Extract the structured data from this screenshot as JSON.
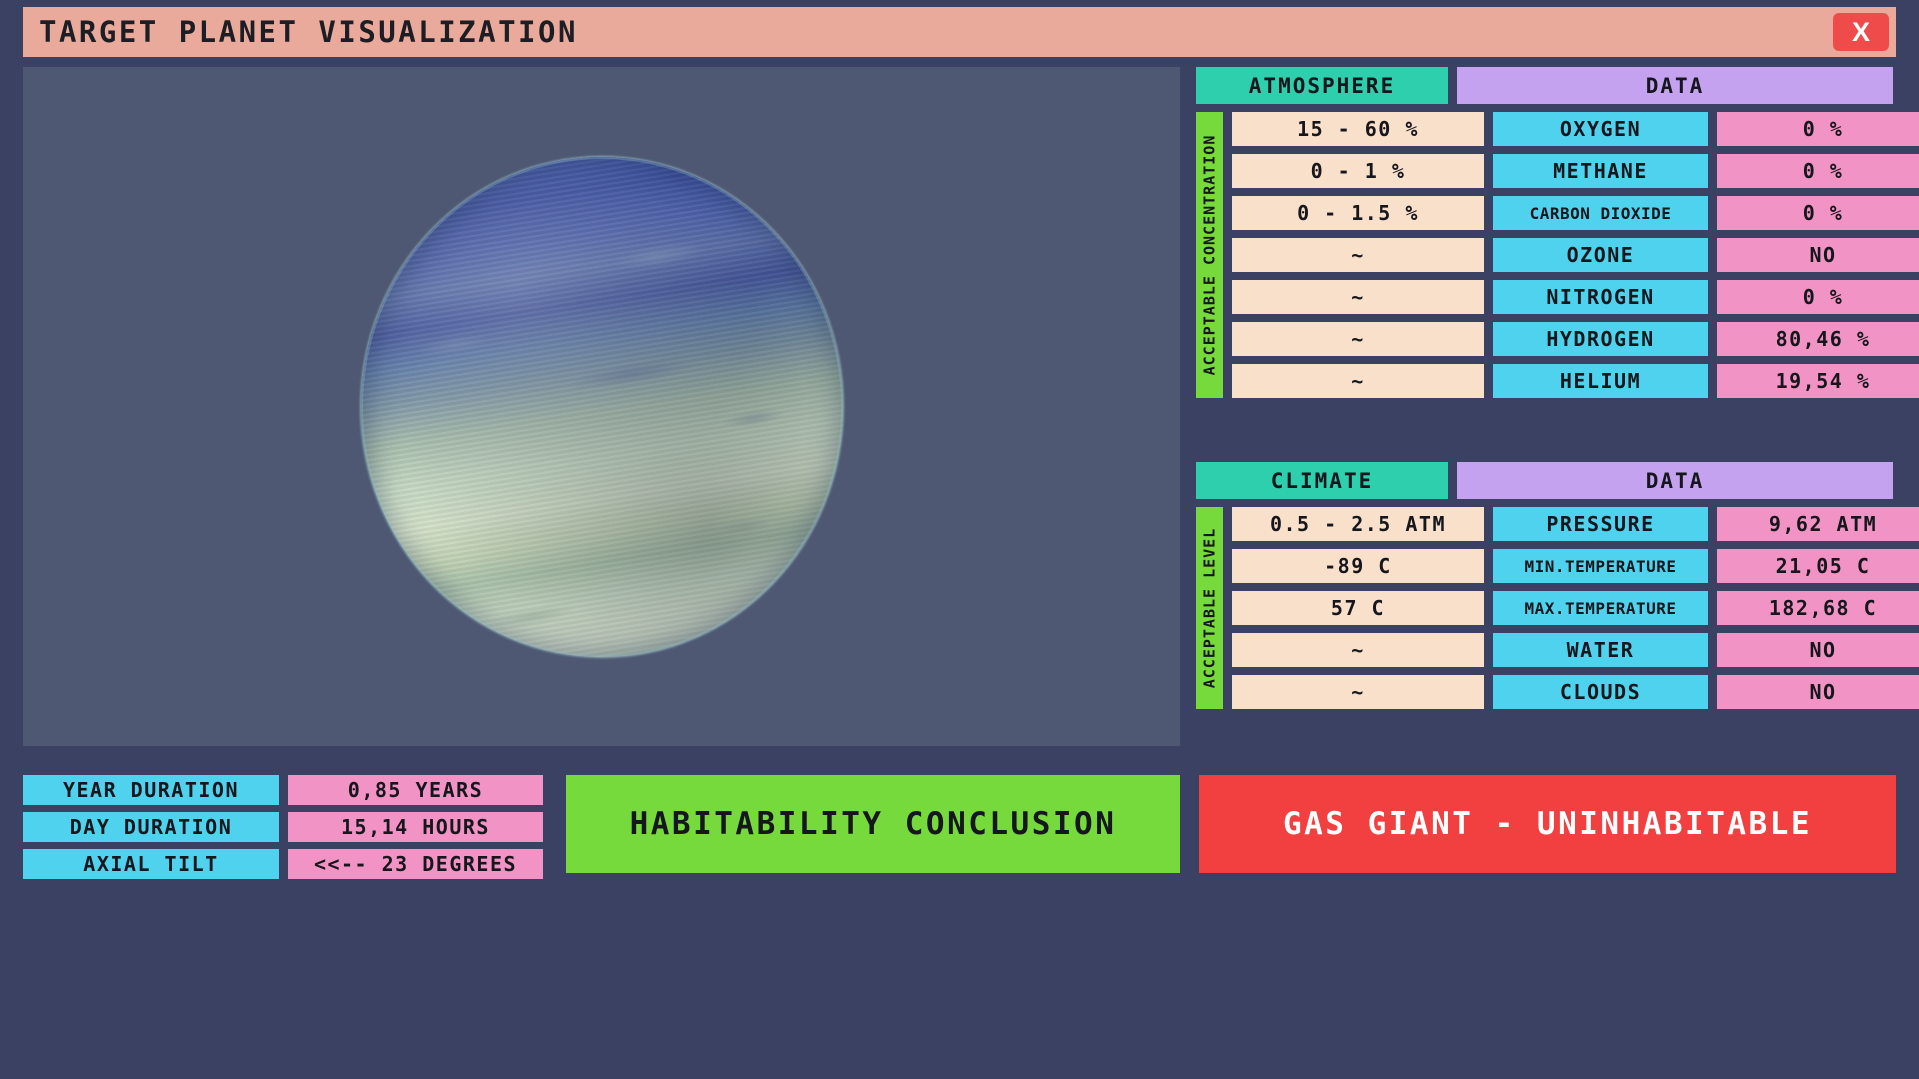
{
  "window": {
    "title": "TARGET PLANET VISUALIZATION",
    "close_label": "X"
  },
  "viewport": {
    "planet_name": "gas-giant-sphere"
  },
  "atmosphere": {
    "header_left": "ATMOSPHERE",
    "header_right": "DATA",
    "side_label": "ACCEPTABLE CONCENTRATION",
    "rows": [
      {
        "acceptable": "15 - 60 %",
        "name": "OXYGEN",
        "value": "0 %"
      },
      {
        "acceptable": "0 - 1 %",
        "name": "METHANE",
        "value": "0 %"
      },
      {
        "acceptable": "0 - 1.5 %",
        "name": "CARBON DIOXIDE",
        "value": "0 %"
      },
      {
        "acceptable": "~",
        "name": "OZONE",
        "value": "NO"
      },
      {
        "acceptable": "~",
        "name": "NITROGEN",
        "value": "0 %"
      },
      {
        "acceptable": "~",
        "name": "HYDROGEN",
        "value": "80,46 %"
      },
      {
        "acceptable": "~",
        "name": "HELIUM",
        "value": "19,54 %"
      }
    ]
  },
  "climate": {
    "header_left": "CLIMATE",
    "header_right": "DATA",
    "side_label": "ACCEPTABLE LEVEL",
    "rows": [
      {
        "acceptable": "0.5 - 2.5 ATM",
        "name": "PRESSURE",
        "value": "9,62 ATM"
      },
      {
        "acceptable": "-89 C",
        "name": "MIN.TEMPERATURE",
        "value": "21,05 C"
      },
      {
        "acceptable": "57 C",
        "name": "MAX.TEMPERATURE",
        "value": "182,68 C"
      },
      {
        "acceptable": "~",
        "name": "WATER",
        "value": "NO"
      },
      {
        "acceptable": "~",
        "name": "CLOUDS",
        "value": "NO"
      }
    ]
  },
  "orbital": {
    "rows": [
      {
        "label": "YEAR DURATION",
        "value": "0,85 YEARS"
      },
      {
        "label": "DAY DURATION",
        "value": "15,14 HOURS"
      },
      {
        "label": "AXIAL TILT",
        "value": "<<-- 23 DEGREES"
      }
    ]
  },
  "habitability": {
    "heading": "HABITABILITY CONCLUSION",
    "verdict": "GAS GIANT - UNINHABITABLE"
  },
  "colors": {
    "page_background": "#3b4162",
    "viewport_background": "#4e5872",
    "titlebar": "#eaaa9b",
    "close_button": "#ef4b4b",
    "header_teal": "#2ecfad",
    "header_purple": "#c4a2ef",
    "side_green": "#76d93c",
    "cell_cream": "#f9e0cb",
    "cell_cyan": "#4fd2ed",
    "cell_pink": "#f193c4",
    "verdict_red": "#f23f40"
  }
}
